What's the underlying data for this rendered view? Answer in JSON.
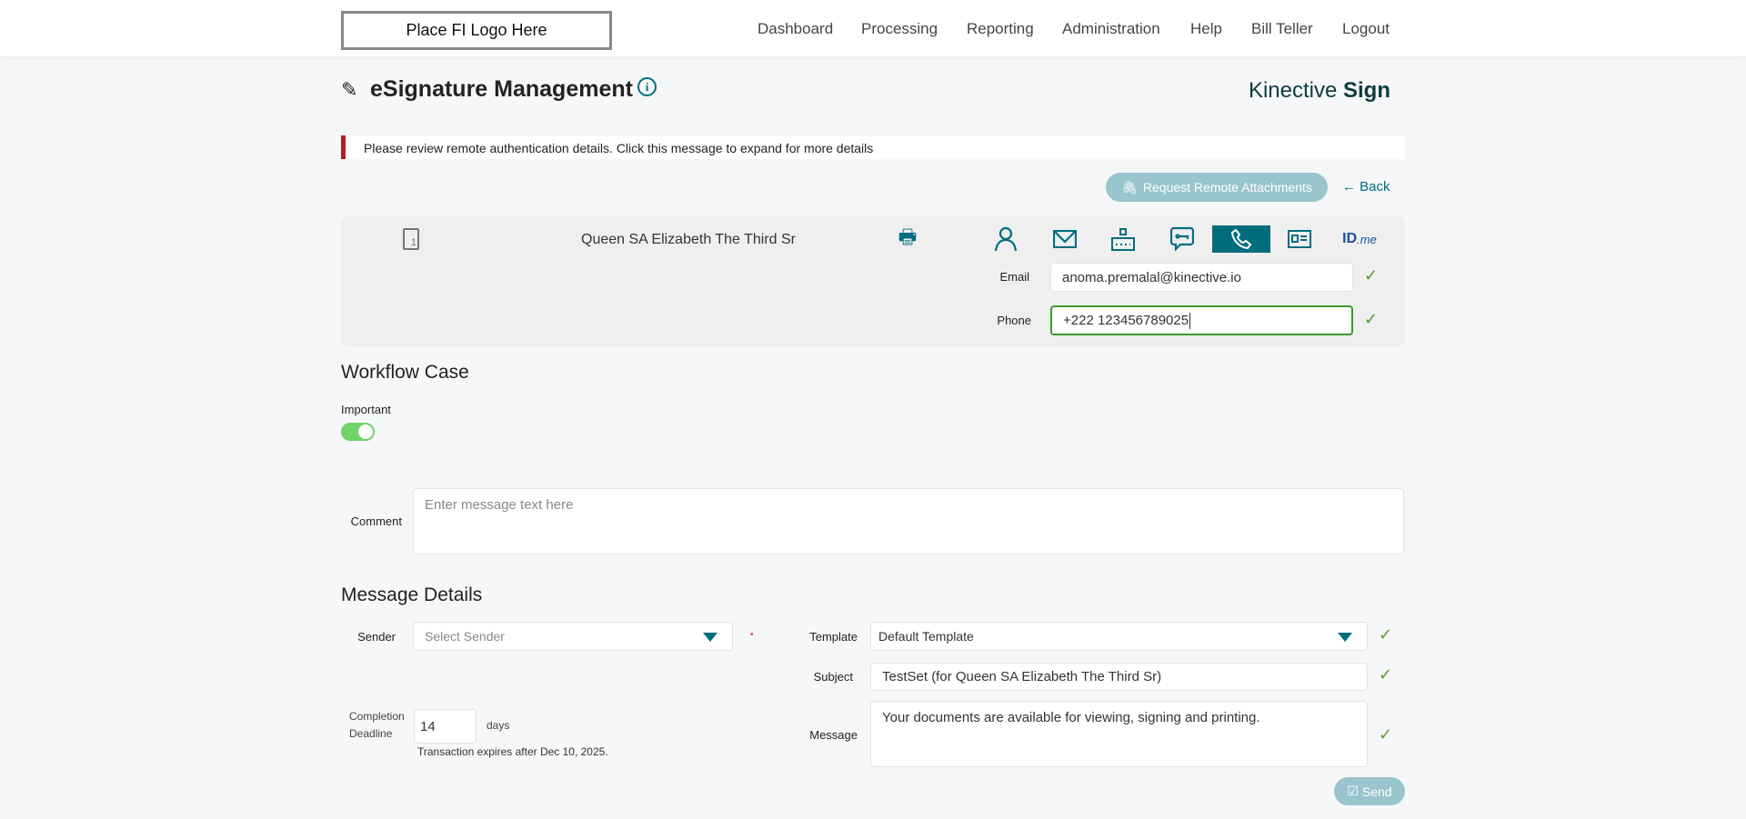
{
  "header": {
    "logo": "Place FI Logo Here",
    "nav": [
      "Dashboard",
      "Processing",
      "Reporting",
      "Administration",
      "Help",
      "Bill Teller",
      "Logout"
    ]
  },
  "page": {
    "title": "eSignature Management",
    "brand_light": "Kinective",
    "brand_bold": "Sign"
  },
  "alert": {
    "text": "Please review remote authentication details. Click this message to expand for more details",
    "color": "#b71c1c"
  },
  "actions": {
    "request_attachments": "Request Remote Attachments",
    "back": "Back"
  },
  "signer": {
    "name": "Queen SA Elizabeth The Third Sr",
    "doc_count": "1",
    "auth_icons": [
      "person-icon",
      "envelope-icon",
      "access-code-icon",
      "sms-key-icon",
      "phone-icon",
      "id-card-icon",
      "idme-icon"
    ],
    "active_auth": "phone-icon",
    "idme_label": "ID",
    "idme_suffix": ".me",
    "email_label": "Email",
    "email_value": "anoma.premalal@kinective.io",
    "phone_label": "Phone",
    "phone_value": "+222 123456789025"
  },
  "workflow": {
    "heading": "Workflow Case",
    "important_label": "Important",
    "important_on": true,
    "comment_label": "Comment",
    "comment_placeholder": "Enter message text here"
  },
  "message": {
    "heading": "Message Details",
    "sender_label": "Sender",
    "sender_placeholder": "Select Sender",
    "template_label": "Template",
    "template_value": "Default Template",
    "subject_label": "Subject",
    "subject_value": "TestSet (for Queen SA Elizabeth The Third Sr)",
    "message_label": "Message",
    "message_value": "Your documents are available for viewing, signing and printing.",
    "deadline_label_1": "Completion",
    "deadline_label_2": "Deadline",
    "deadline_value": "14",
    "deadline_unit": "days",
    "expires_text": "Transaction expires after Dec 10, 2025.",
    "send": "Send"
  },
  "colors": {
    "accent": "#006d7e",
    "valid": "#5aa02c",
    "toggle": "#6fd36a"
  }
}
